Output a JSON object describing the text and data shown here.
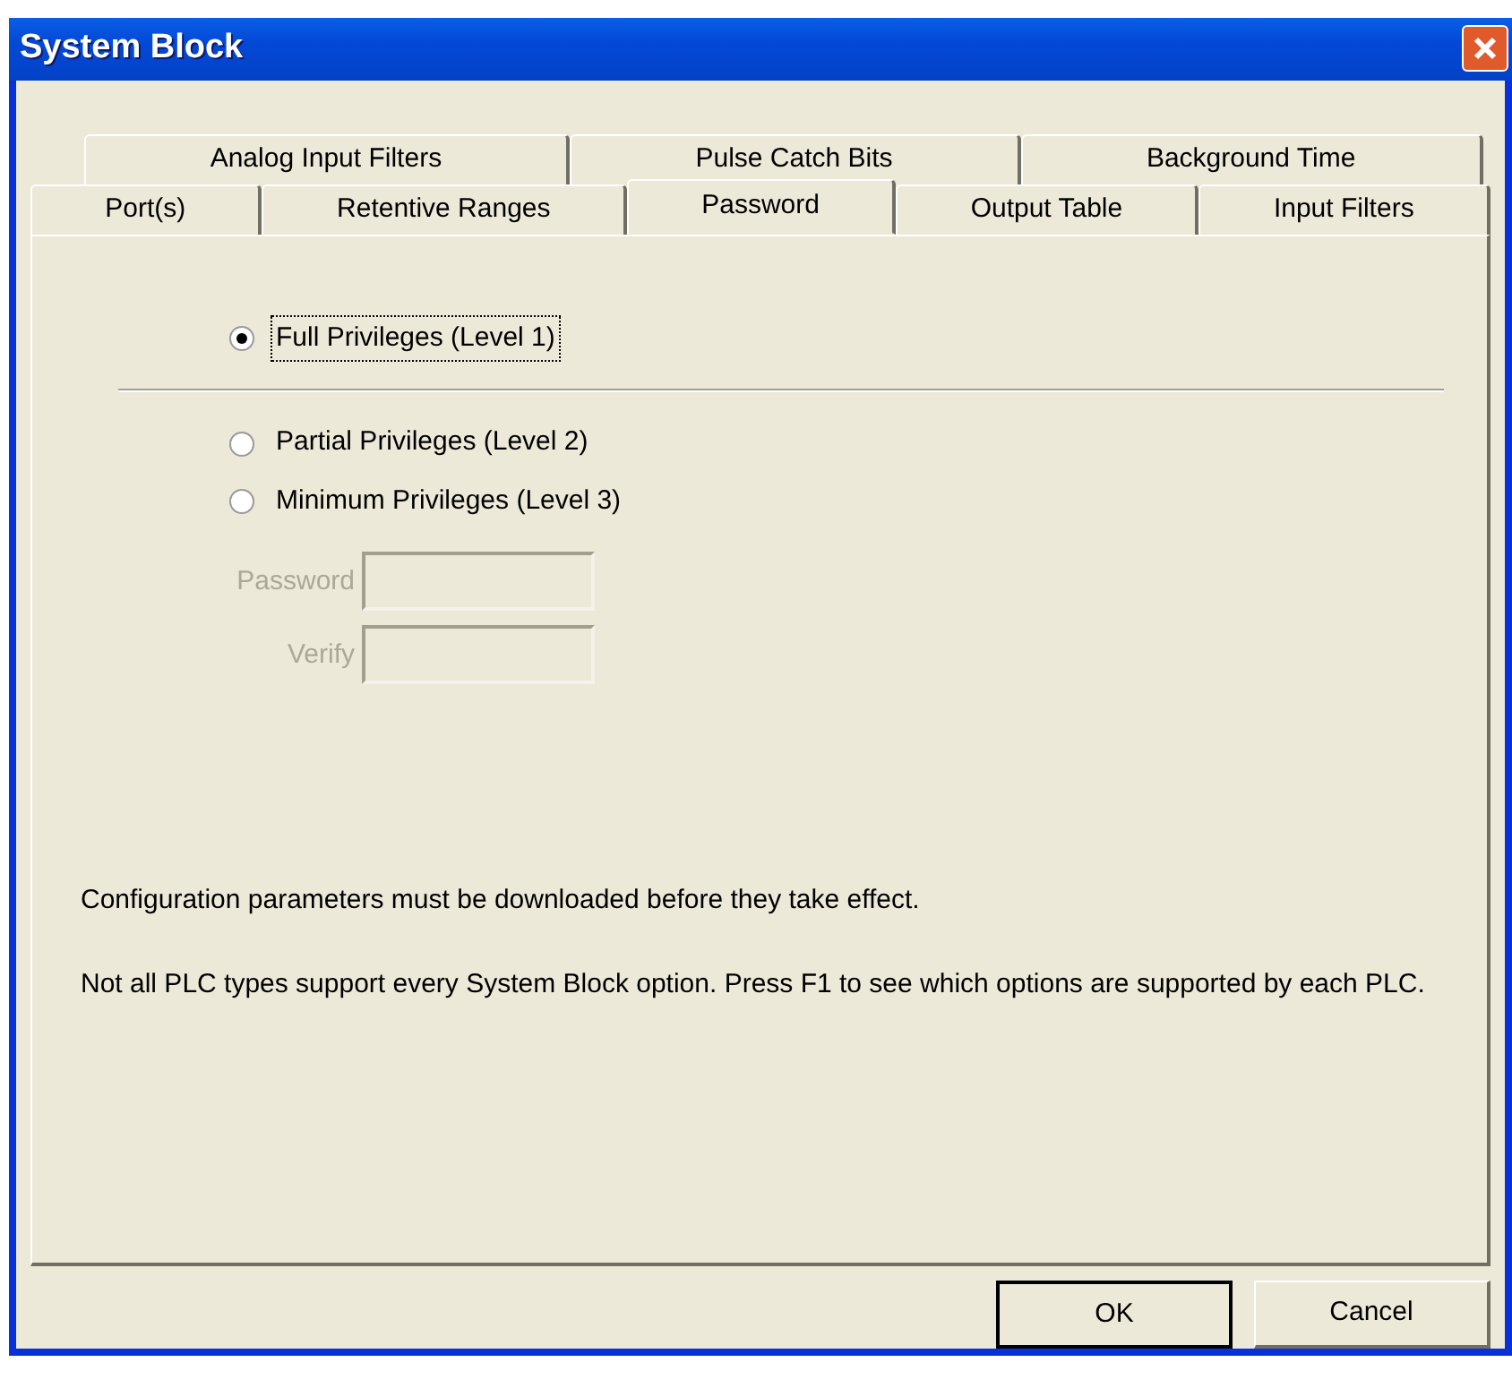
{
  "window": {
    "title": "System Block"
  },
  "tab_rows": [
    {
      "tabs": [
        {
          "label": "Analog Input Filters",
          "selected": false
        },
        {
          "label": "Pulse Catch Bits",
          "selected": false
        },
        {
          "label": "Background Time",
          "selected": false
        }
      ]
    },
    {
      "tabs": [
        {
          "label": "Port(s)",
          "selected": false
        },
        {
          "label": "Retentive Ranges",
          "selected": false
        },
        {
          "label": "Password",
          "selected": true
        },
        {
          "label": "Output Table",
          "selected": false
        },
        {
          "label": "Input Filters",
          "selected": false
        }
      ]
    }
  ],
  "privileges_top": [
    {
      "label": "Full Privileges (Level 1)",
      "selected": true,
      "focused": true
    }
  ],
  "privileges": [
    {
      "label": "Partial Privileges (Level 2)",
      "selected": false
    },
    {
      "label": "Minimum Privileges (Level 3)",
      "selected": false
    }
  ],
  "fields": [
    {
      "label": "Password",
      "disabled": true
    },
    {
      "label": "Verify",
      "disabled": true
    }
  ],
  "notes": [
    "Configuration parameters must be downloaded before they take effect.",
    "Not all PLC types support every System Block option.  Press F1 to see which options are supported by each PLC."
  ],
  "buttons": [
    {
      "label": "OK",
      "default": true
    },
    {
      "label": "Cancel",
      "default": false
    }
  ]
}
